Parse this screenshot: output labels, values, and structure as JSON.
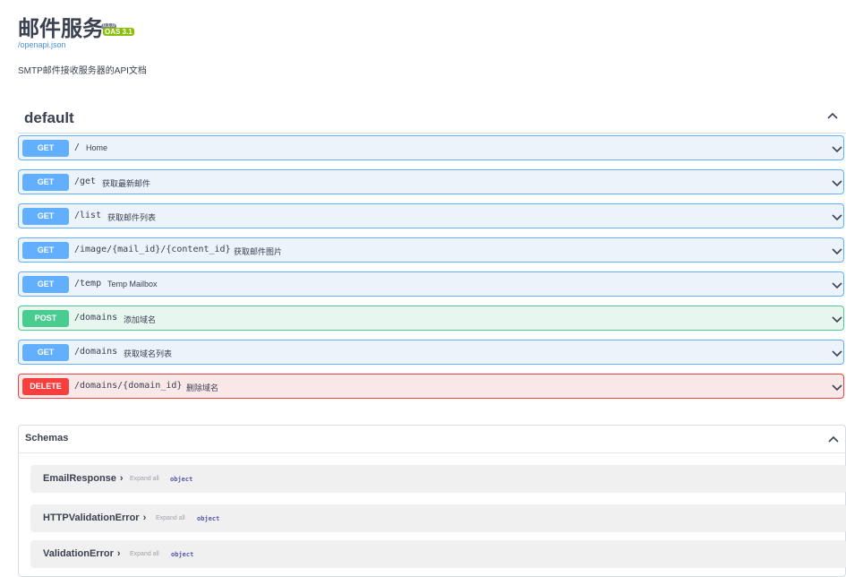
{
  "header": {
    "title": "邮件服务",
    "version_badge": "0.1.0",
    "oas_badge": "OAS 3.1",
    "spec_link": "/openapi.json",
    "description": "SMTP邮件接收服务器的API文档"
  },
  "tag": {
    "name": "default"
  },
  "operations": [
    {
      "method": "GET",
      "path": "/",
      "summary": "Home"
    },
    {
      "method": "GET",
      "path": "/get",
      "summary": "获取最新邮件"
    },
    {
      "method": "GET",
      "path": "/list",
      "summary": "获取邮件列表"
    },
    {
      "method": "GET",
      "path": "/image/{mail_id}/{content_id}",
      "summary": "获取邮件图片"
    },
    {
      "method": "GET",
      "path": "/temp",
      "summary": "Temp Mailbox"
    },
    {
      "method": "POST",
      "path": "/domains",
      "summary": "添加域名"
    },
    {
      "method": "GET",
      "path": "/domains",
      "summary": "获取域名列表"
    },
    {
      "method": "DELETE",
      "path": "/domains/{domain_id}",
      "summary": "删除域名"
    }
  ],
  "schemas": {
    "title": "Schemas",
    "models": [
      {
        "name": "EmailResponse",
        "expand_label": "Expand all",
        "type_label": "object"
      },
      {
        "name": "HTTPValidationError",
        "expand_label": "Expand all",
        "type_label": "object"
      },
      {
        "name": "ValidationError",
        "expand_label": "Expand all",
        "type_label": "object"
      }
    ]
  },
  "colors": {
    "get": "#61affe",
    "post": "#49cc90",
    "delete": "#f93e3e",
    "link": "#4990e2"
  }
}
